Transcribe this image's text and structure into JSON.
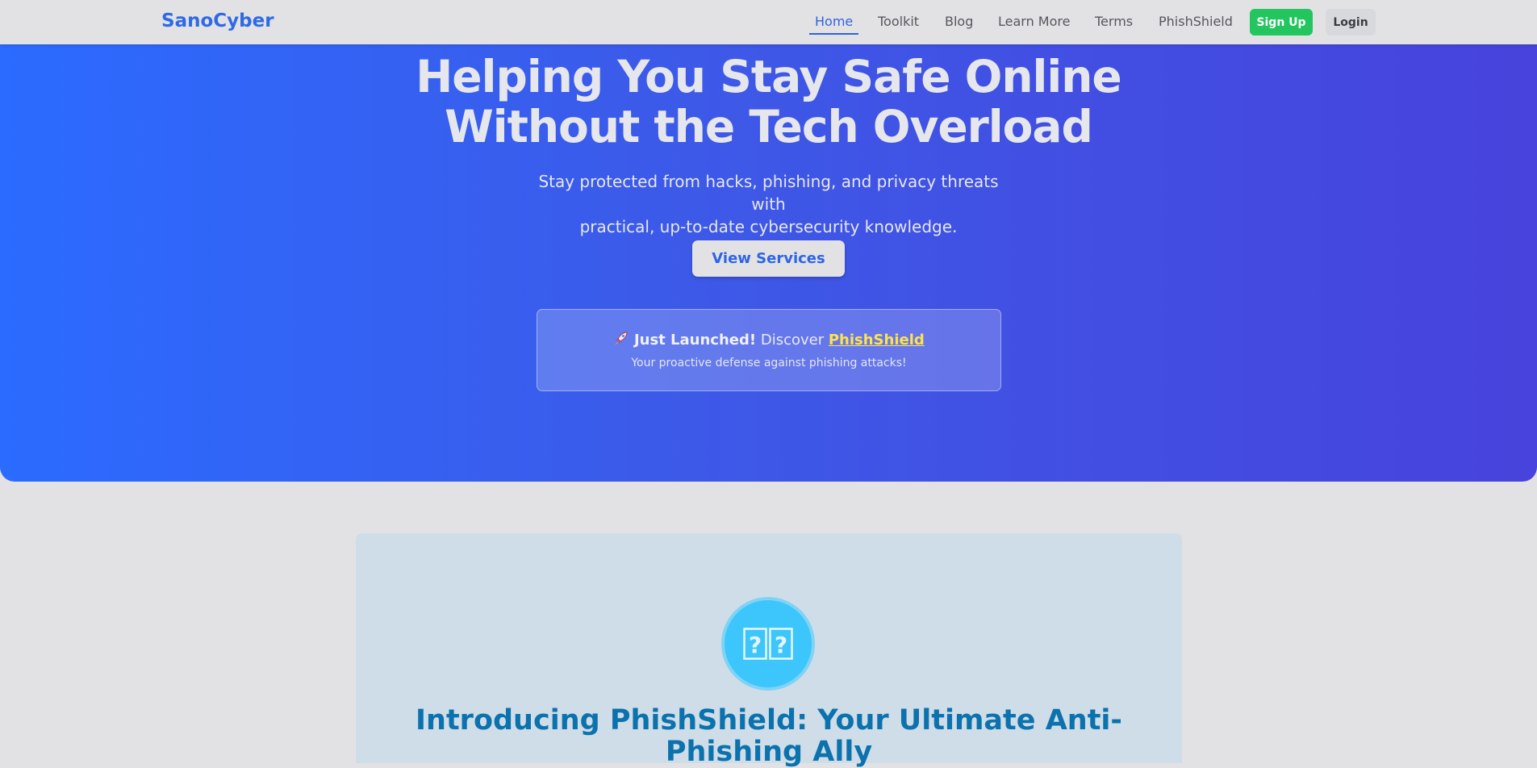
{
  "nav": {
    "brand": "SanoCyber",
    "links": [
      "Home",
      "Toolkit",
      "Blog",
      "Learn More",
      "Terms",
      "PhishShield"
    ],
    "active": "Home",
    "signup_label": "Sign Up",
    "login_label": "Login"
  },
  "hero": {
    "title_line1": "Helping You Stay Safe Online",
    "title_line2": "Without the Tech Overload",
    "subtitle_line1": "Stay protected from hacks, phishing, and privacy threats with",
    "subtitle_line2": "practical, up-to-date cybersecurity knowledge.",
    "cta_label": "View Services"
  },
  "banner": {
    "icon": "rocket-icon",
    "highlight": "Just Launched!",
    "text": "Discover",
    "link_label": "PhishShield",
    "description": "Your proactive defense against phishing attacks!"
  },
  "card": {
    "icon": "placeholder-glyph-icon",
    "title": "Introducing PhishShield: Your Ultimate Anti-Phishing Ally"
  },
  "colors": {
    "brand_blue": "#2f6ae6",
    "hero_gradient_start": "#2b6bff",
    "hero_gradient_end": "#4743dc",
    "signup_green": "#22c55e",
    "banner_link_yellow": "#ffe34a",
    "card_title": "#0c72ad",
    "icon_circle": "#3cc6fb"
  }
}
